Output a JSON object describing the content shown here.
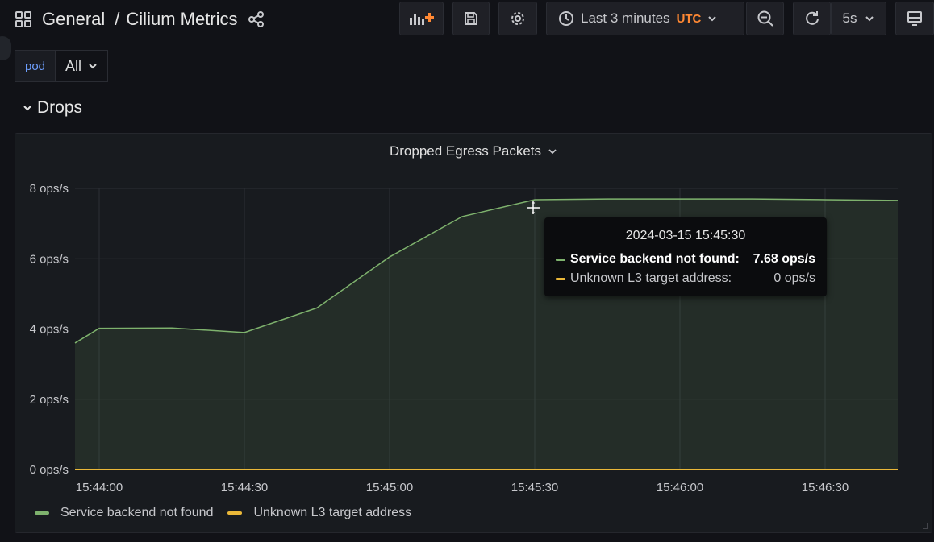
{
  "header": {
    "folder": "General",
    "separator": "/",
    "dashboard": "Cilium Metrics"
  },
  "toolbar": {
    "time_range": "Last 3 minutes",
    "timezone": "UTC",
    "refresh_interval": "5s"
  },
  "variables": {
    "pod_label": "pod",
    "pod_value": "All"
  },
  "row": {
    "title": "Drops"
  },
  "panel": {
    "title": "Dropped Egress Packets"
  },
  "tooltip": {
    "time": "2024-03-15 15:45:30",
    "rows": [
      {
        "name": "Service backend not found:",
        "value": "7.68 ops/s"
      },
      {
        "name": "Unknown L3 target address:",
        "value": "0 ops/s"
      }
    ]
  },
  "colors": {
    "series_green": "#7eb26d",
    "series_yellow": "#eab839",
    "accent_orange": "#ff8833"
  },
  "chart_data": {
    "type": "area",
    "title": "Dropped Egress Packets",
    "y_ticks": [
      "0 ops/s",
      "2 ops/s",
      "4 ops/s",
      "6 ops/s",
      "8 ops/s"
    ],
    "x_ticks": [
      "15:44:00",
      "15:44:30",
      "15:45:00",
      "15:45:30",
      "15:46:00",
      "15:46:30"
    ],
    "ylim": [
      0,
      8
    ],
    "xlim": [
      "15:43:55",
      "15:46:45"
    ],
    "grid": true,
    "legend_position": "bottom-left",
    "series": [
      {
        "name": "Service backend not found",
        "color": "#7eb26d",
        "x": [
          "15:43:55",
          "15:44:00",
          "15:44:15",
          "15:44:30",
          "15:44:45",
          "15:45:00",
          "15:45:15",
          "15:45:30",
          "15:45:45",
          "15:46:00",
          "15:46:15",
          "15:46:30",
          "15:46:45"
        ],
        "values": [
          3.6,
          4.02,
          4.03,
          3.9,
          4.6,
          6.05,
          7.2,
          7.68,
          7.7,
          7.7,
          7.7,
          7.68,
          7.66
        ]
      },
      {
        "name": "Unknown L3 target address",
        "color": "#eab839",
        "x": [
          "15:43:55",
          "15:46:45"
        ],
        "values": [
          0,
          0
        ]
      }
    ]
  }
}
